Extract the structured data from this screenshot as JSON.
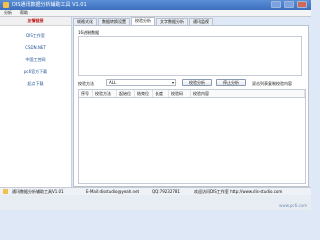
{
  "window": {
    "title": "DIS通讯数据分析辅助工具 V1.01"
  },
  "menu": {
    "items": [
      "分析",
      "帮助"
    ]
  },
  "sidebar": {
    "header": "友情链接",
    "links": [
      "DIS工作室",
      "CSDN.NET",
      "中国工控网",
      "pc6官方下载",
      "起点下载"
    ]
  },
  "tabs": [
    "帧格式化",
    "数据转换设置",
    "校验分析",
    "文字数据分析",
    "通讯监视"
  ],
  "active_tab": "校验分析",
  "panel": {
    "hex_label": "16进制数据",
    "method_label": "校验方法",
    "method_value": "ALL",
    "btn_analyze": "校验分析",
    "btn_stop": "停止分析",
    "note": "双击列表复制校验内容"
  },
  "table": {
    "headers": [
      "序号",
      "校验方法",
      "起始位",
      "结束位",
      "长度",
      "校验码",
      "校验内容"
    ]
  },
  "status": {
    "app": "通讯数据分析辅助工具V1.01",
    "email": "E-Mail:disstudio@yeah.net",
    "qq": "QQ:79232781",
    "visit": "欢迎访问DIS工作室 http://www.dis-studio.com"
  },
  "watermark": "www.pc6.com"
}
